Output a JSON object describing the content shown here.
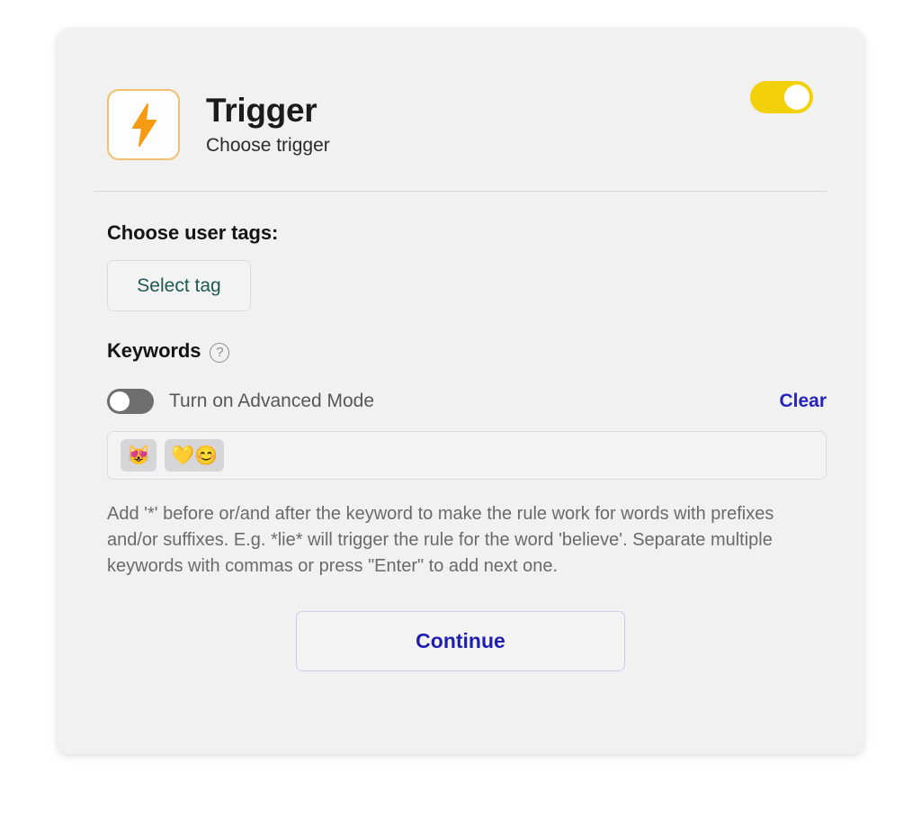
{
  "card": {
    "header": {
      "icon": "lightning-bolt-icon",
      "title": "Trigger",
      "subtitle": "Choose trigger",
      "enabled_toggle": {
        "state": "on",
        "accent_color": "#f2d10a"
      }
    },
    "user_tags": {
      "label": "Choose user tags:",
      "select_button_label": "Select tag",
      "select_button_color": "#1d5951"
    },
    "keywords": {
      "label": "Keywords",
      "help_icon": "question-mark-circle-icon",
      "advanced_mode": {
        "label": "Turn on Advanced Mode",
        "state": "off"
      },
      "clear_label": "Clear",
      "clear_color": "#2525bb",
      "chips": [
        {
          "text": "😻"
        },
        {
          "text": "💛😊"
        }
      ],
      "input_placeholder": "",
      "hint": "Add '*' before or/and after the keyword to make the rule work for words with prefixes and/or suffixes. E.g. *lie* will trigger the rule for the word 'believe'. Separate multiple keywords with commas or press \"Enter\" to add next one."
    },
    "footer": {
      "continue_label": "Continue",
      "continue_color": "#1f1fae"
    }
  }
}
